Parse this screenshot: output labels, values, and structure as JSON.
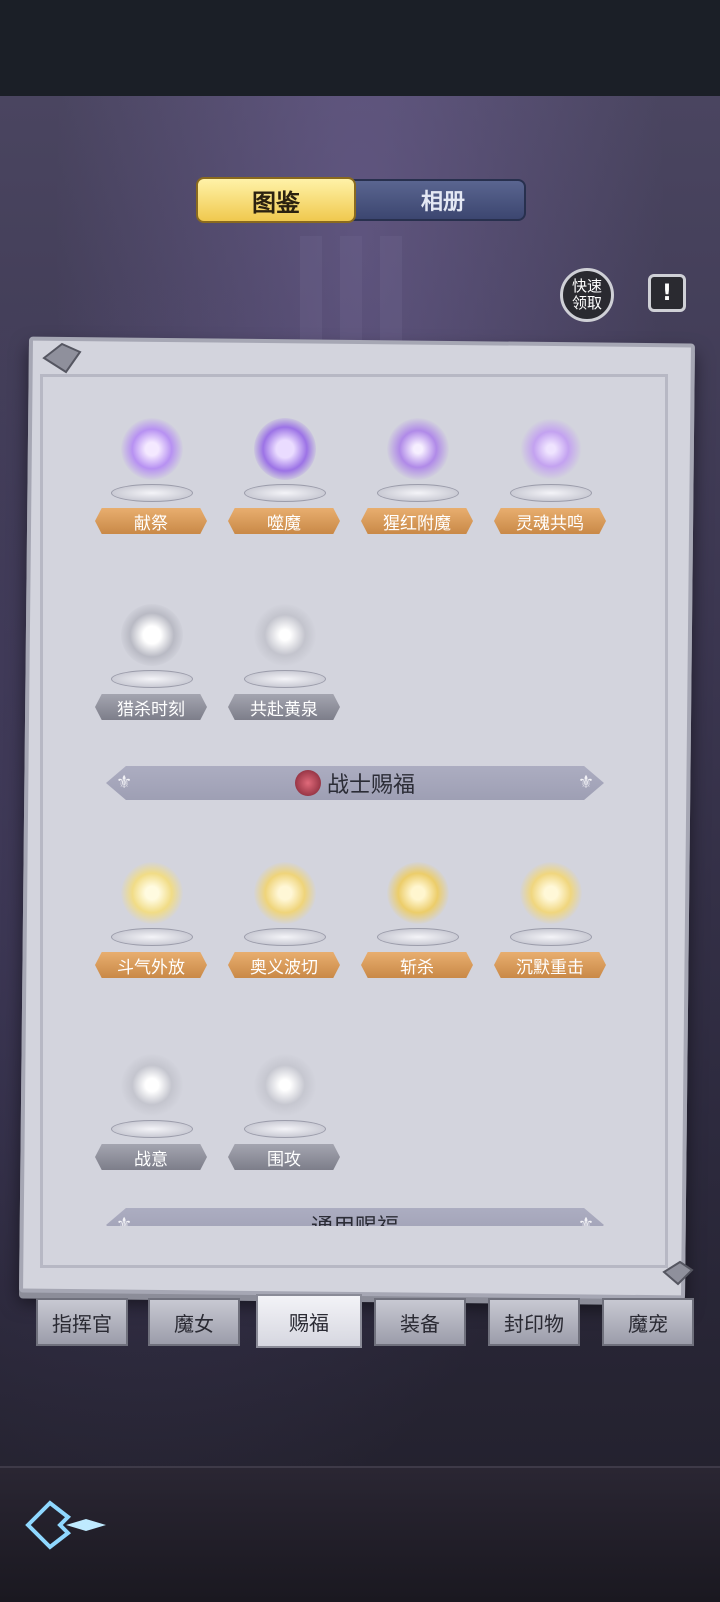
{
  "toggle": {
    "active_label": "图鉴",
    "inactive_label": "相册"
  },
  "quick_claim": {
    "line1": "快速",
    "line2": "领取"
  },
  "info": {
    "label": "!"
  },
  "curse_items": [
    {
      "label": "献祭",
      "icon": "purple-flame-icon",
      "style": "orange"
    },
    {
      "label": "噬魔",
      "icon": "purple-orb-icon",
      "style": "orange"
    },
    {
      "label": "猩红附魔",
      "icon": "purple-vortex-icon",
      "style": "orange"
    },
    {
      "label": "灵魂共鸣",
      "icon": "purple-totem-icon",
      "style": "orange"
    },
    {
      "label": "猎杀时刻",
      "icon": "grabbing-hand-icon",
      "style": "gray"
    },
    {
      "label": "共赴黄泉",
      "icon": "spirit-figure-icon",
      "style": "gray"
    }
  ],
  "warrior_section": {
    "title": "战士赐福",
    "icon": "feather-badge-icon"
  },
  "warrior_items": [
    {
      "label": "斗气外放",
      "icon": "crescent-slash-icon",
      "style": "orange"
    },
    {
      "label": "奥义波切",
      "icon": "blade-wave-icon",
      "style": "orange"
    },
    {
      "label": "斩杀",
      "icon": "spinning-figure-icon",
      "style": "orange"
    },
    {
      "label": "沉默重击",
      "icon": "fist-burst-icon",
      "style": "orange"
    },
    {
      "label": "战意",
      "icon": "crossed-swords-icon",
      "style": "gray"
    },
    {
      "label": "围攻",
      "icon": "swords-cluster-icon",
      "style": "gray"
    }
  ],
  "general_section": {
    "title": "通用赐福"
  },
  "bottom_tabs": [
    {
      "label": "指挥官",
      "active": false
    },
    {
      "label": "魔女",
      "active": false
    },
    {
      "label": "赐福",
      "active": true
    },
    {
      "label": "装备",
      "active": false
    },
    {
      "label": "封印物",
      "active": false
    },
    {
      "label": "魔宠",
      "active": false
    }
  ],
  "colors": {
    "accent_gold": "#f0c94e",
    "label_orange": "#d99a58",
    "label_gray": "#8d8e99",
    "panel": "#d3d4dd"
  }
}
